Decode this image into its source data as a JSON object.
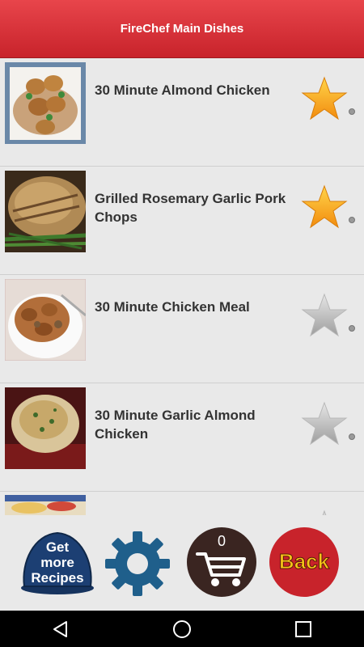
{
  "header": {
    "title": "FireChef Main Dishes"
  },
  "recipes": [
    {
      "title": "30 Minute Almond Chicken",
      "favorite": true
    },
    {
      "title": "Grilled Rosemary Garlic Pork Chops",
      "favorite": true
    },
    {
      "title": "30 Minute Chicken Meal",
      "favorite": false
    },
    {
      "title": "30 Minute Garlic Almond Chicken",
      "favorite": false
    },
    {
      "title": "",
      "favorite": false
    }
  ],
  "toolbar": {
    "get_more_line1": "Get",
    "get_more_line2": "more",
    "get_more_line3": "Recipes",
    "cart_count": "0",
    "back_label": "Back"
  },
  "icons": {
    "favorite_on": "star-gold-icon",
    "favorite_off": "star-gray-icon",
    "settings": "gear-icon",
    "cart": "shopping-cart-icon",
    "nav_back": "triangle-back-icon",
    "nav_home": "circle-home-icon",
    "nav_recents": "square-recents-icon"
  },
  "colors": {
    "header_red": "#d8313a",
    "star_gold": "#f7a51c",
    "settings_blue": "#1f5f8b",
    "back_red": "#c8232b",
    "back_text": "#f5c518"
  }
}
